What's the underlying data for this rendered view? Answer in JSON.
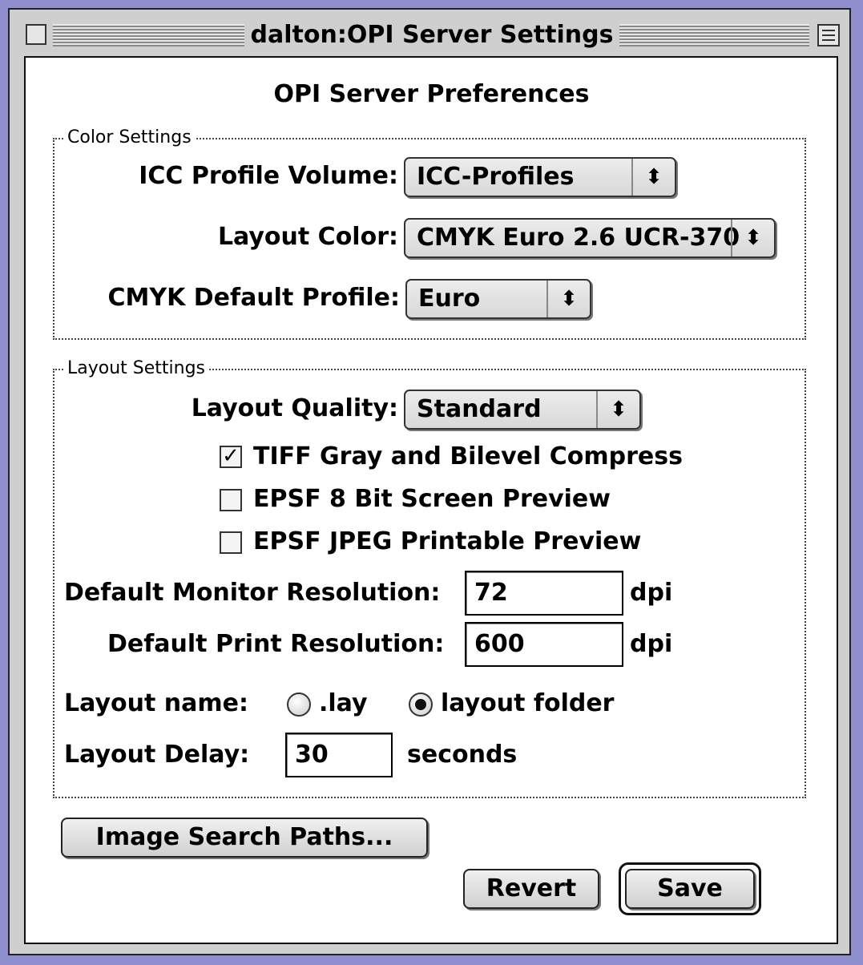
{
  "window": {
    "title": "dalton:OPI Server Settings"
  },
  "heading": "OPI Server Preferences",
  "color_settings": {
    "group_label": "Color Settings",
    "icc_profile_volume": {
      "label": "ICC Profile Volume:",
      "value": "ICC-Profiles"
    },
    "layout_color": {
      "label": "Layout Color:",
      "value": "CMYK Euro 2.6 UCR-370"
    },
    "cmyk_default_profile": {
      "label": "CMYK Default Profile:",
      "value": "Euro"
    }
  },
  "layout_settings": {
    "group_label": "Layout Settings",
    "layout_quality": {
      "label": "Layout Quality:",
      "value": "Standard"
    },
    "checkboxes": [
      {
        "label": "TIFF Gray and Bilevel Compress",
        "checked": true
      },
      {
        "label": "EPSF 8 Bit Screen Preview",
        "checked": false
      },
      {
        "label": "EPSF JPEG Printable Preview",
        "checked": false
      }
    ],
    "monitor_resolution": {
      "label": "Default Monitor Resolution:",
      "value": "72",
      "unit": "dpi"
    },
    "print_resolution": {
      "label": "Default Print Resolution:",
      "value": "600",
      "unit": "dpi"
    },
    "layout_name": {
      "label": "Layout name:",
      "options": [
        {
          "label": ".lay",
          "selected": false
        },
        {
          "label": "layout folder",
          "selected": true
        }
      ]
    },
    "layout_delay": {
      "label": "Layout Delay:",
      "value": "30",
      "unit": "seconds"
    }
  },
  "buttons": {
    "image_search_paths": "Image Search Paths...",
    "revert": "Revert",
    "save": "Save"
  },
  "check_mark": "✓",
  "arrows_glyph": "⬍"
}
